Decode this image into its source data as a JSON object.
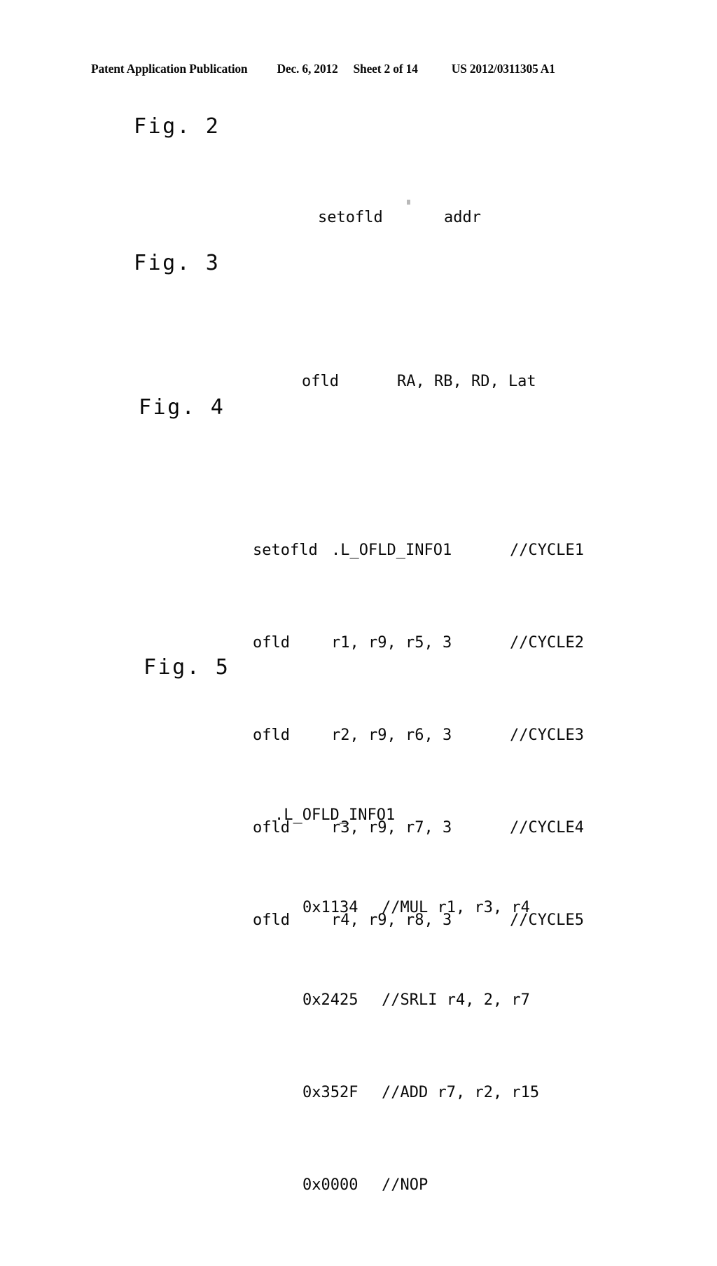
{
  "header": {
    "publication": "Patent Application Publication",
    "date": "Dec. 6, 2012",
    "sheet": "Sheet 2 of 14",
    "document_number": "US 2012/0311305 A1"
  },
  "figures": {
    "fig2": {
      "label": "Fig. 2",
      "mnemonic": "setofld",
      "operand": "addr"
    },
    "fig3": {
      "label": "Fig. 3",
      "mnemonic": "ofld",
      "operand": "RA, RB, RD, Lat"
    },
    "fig4": {
      "label": "Fig. 4",
      "lines": [
        {
          "mnemonic": "setofld",
          "operand": ".L_OFLD_INFO1",
          "comment": "//CYCLE1"
        },
        {
          "mnemonic": "ofld",
          "operand": "r1, r9, r5, 3",
          "comment": "//CYCLE2"
        },
        {
          "mnemonic": "ofld",
          "operand": "r2, r9, r6, 3",
          "comment": "//CYCLE3"
        },
        {
          "mnemonic": "ofld",
          "operand": "r3, r9, r7, 3",
          "comment": "//CYCLE4"
        },
        {
          "mnemonic": "ofld",
          "operand": "r4, r9, r8, 3",
          "comment": "//CYCLE5"
        }
      ]
    },
    "fig5": {
      "label": "Fig. 5",
      "block_label": ".L_OFLD_INFO1",
      "lines": [
        {
          "hex": "0x1134",
          "comment": "//MUL r1, r3, r4"
        },
        {
          "hex": "0x2425",
          "comment": "//SRLI r4, 2, r7"
        },
        {
          "hex": "0x352F",
          "comment": "//ADD r7, r2, r15"
        },
        {
          "hex": "0x0000",
          "comment": "//NOP"
        }
      ]
    }
  }
}
